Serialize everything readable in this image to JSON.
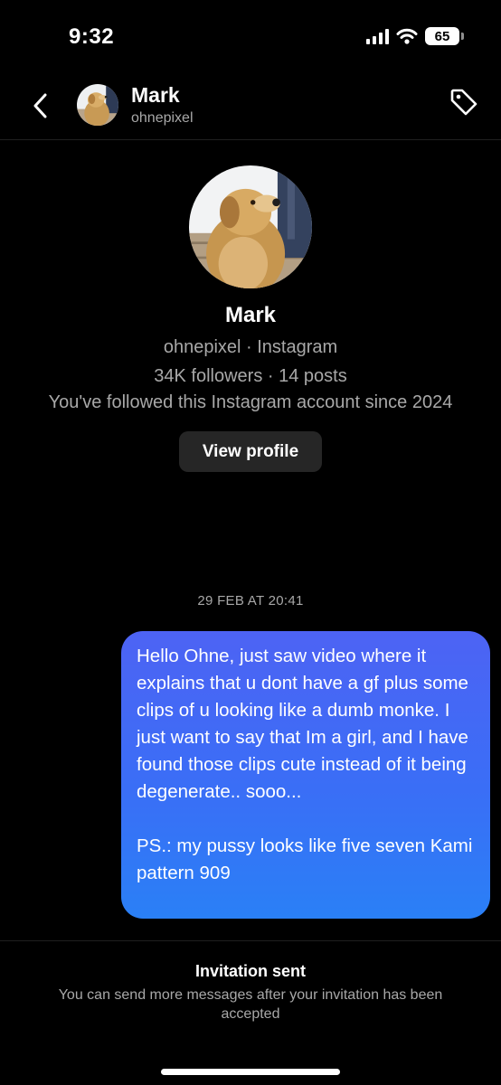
{
  "status_bar": {
    "time": "9:32",
    "battery": "65",
    "icons": [
      "signal-icon",
      "wifi-icon",
      "battery-icon"
    ]
  },
  "header": {
    "name": "Mark",
    "username": "ohnepixel",
    "icons": [
      "chevron-left-icon",
      "tag-icon"
    ]
  },
  "profile": {
    "name": "Mark",
    "subtitle": "ohnepixel · Instagram",
    "stats": "34K followers · 14 posts",
    "followed_since": "You've followed this Instagram account since 2024",
    "view_profile_label": "View profile"
  },
  "conversation": {
    "date": "29 FEB AT 20:41",
    "messages": [
      {
        "sender": "me",
        "paragraphs": [
          "Hello Ohne, just saw video where it explains that u dont have a gf plus some clips of u looking like a dumb monke. I just want to say that Im a girl, and I have found those clips cute instead of it being degenerate.. sooo...",
          "PS.: my pussy looks like five seven Kami pattern 909"
        ]
      }
    ]
  },
  "footer": {
    "title": "Invitation sent",
    "note": "You can send more messages after your invitation has been accepted"
  },
  "colors": {
    "bubble_top": "#4d63f4",
    "bubble_bottom": "#2a80f6",
    "background": "#000000",
    "secondary_text": "#a8a8a8"
  }
}
